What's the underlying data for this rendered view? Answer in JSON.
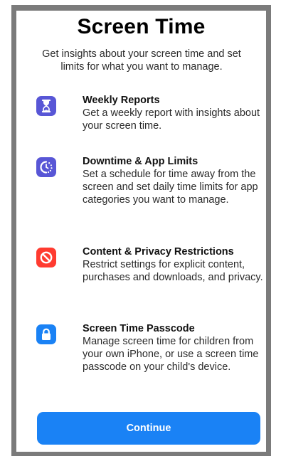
{
  "header": {
    "title": "Screen Time",
    "subtitle": "Get insights about your screen time and set limits for what you want to manage."
  },
  "features": [
    {
      "title": "Weekly Reports",
      "description": "Get a weekly report with insights about your screen time.",
      "icon": "hourglass-icon",
      "color": "#5856d6"
    },
    {
      "title": "Downtime & App Limits",
      "description": "Set a schedule for time away from the screen and set daily time limits for app categories you want to manage.",
      "icon": "downtime-clock-icon",
      "color": "#5856d6"
    },
    {
      "title": "Content & Privacy Restrictions",
      "description": "Restrict settings for explicit content, purchases and downloads, and privacy.",
      "icon": "restriction-icon",
      "color": "#ff3b30"
    },
    {
      "title": "Screen Time Passcode",
      "description": "Manage screen time for children from your own iPhone, or use a screen time passcode on your child's device.",
      "icon": "lock-icon",
      "color": "#1a82f5"
    }
  ],
  "footer": {
    "continue_label": "Continue",
    "button_color": "#1a82f5"
  }
}
